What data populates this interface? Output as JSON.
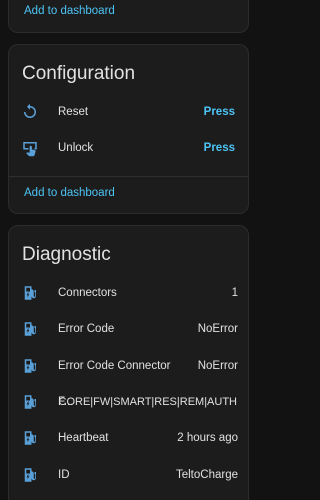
{
  "top_card": {
    "add_to_dashboard": "Add to dashboard"
  },
  "configuration": {
    "title": "Configuration",
    "rows": [
      {
        "label": "Reset",
        "action": "Press",
        "icon": "restart-icon"
      },
      {
        "label": "Unlock",
        "action": "Press",
        "icon": "gesture-tap-button-icon"
      }
    ],
    "add_to_dashboard": "Add to dashboard"
  },
  "diagnostic": {
    "title": "Diagnostic",
    "rows": [
      {
        "label": "Connectors",
        "value": "1",
        "icon": "ev-station-icon"
      },
      {
        "label": "Error Code",
        "value": "NoError",
        "icon": "ev-station-icon"
      },
      {
        "label": "Error Code Connector",
        "value": "NoError",
        "icon": "ev-station-icon"
      },
      {
        "label": "F...",
        "value": "CORE|FW|SMART|RES|REM|AUTH",
        "icon": "ev-station-icon"
      },
      {
        "label": "Heartbeat",
        "value": "2 hours ago",
        "icon": "ev-station-icon"
      },
      {
        "label": "ID",
        "value": "TeltoCharge",
        "icon": "ev-station-icon"
      }
    ]
  },
  "colors": {
    "background": "#121212",
    "card": "#1c1c1c",
    "accent": "#4dc4f5",
    "icon": "#5aa0d8",
    "text": "#e1e1e1"
  }
}
